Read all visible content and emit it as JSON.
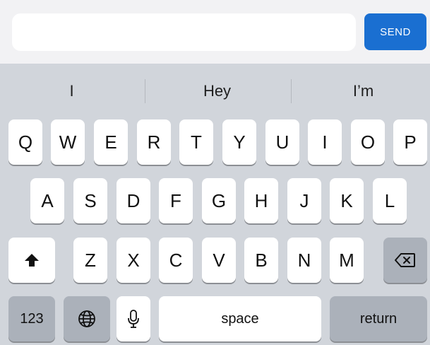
{
  "composer": {
    "input_value": "",
    "input_placeholder": "",
    "send_label": "SEND"
  },
  "suggestions": [
    "I",
    "Hey",
    "I’m"
  ],
  "keyboard": {
    "row1": [
      "Q",
      "W",
      "E",
      "R",
      "T",
      "Y",
      "U",
      "I",
      "O",
      "P"
    ],
    "row2": [
      "A",
      "S",
      "D",
      "F",
      "G",
      "H",
      "J",
      "K",
      "L"
    ],
    "row3": [
      "Z",
      "X",
      "C",
      "V",
      "B",
      "N",
      "M"
    ],
    "numbers_label": "123",
    "space_label": "space",
    "return_label": "return",
    "icons": {
      "shift": "shift-icon",
      "backspace": "backspace-icon",
      "globe": "globe-icon",
      "mic": "microphone-icon"
    }
  },
  "colors": {
    "send_button": "#1a6fd1",
    "keyboard_bg": "#d1d5db",
    "key_bg": "#ffffff",
    "function_key_bg": "#abb1ba"
  }
}
